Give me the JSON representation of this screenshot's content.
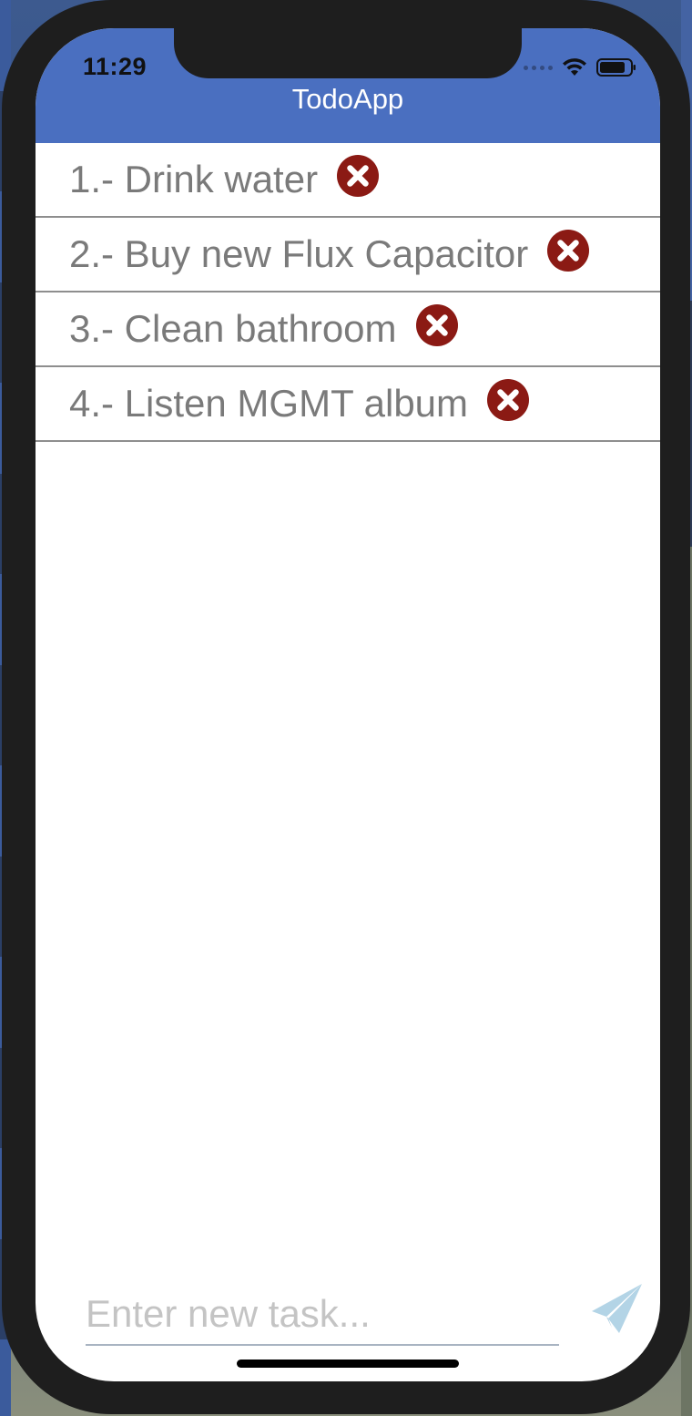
{
  "status_bar": {
    "time": "11:29"
  },
  "header": {
    "title": "TodoApp",
    "background_color": "#4a6fc0"
  },
  "tasks": [
    {
      "label": "1.- Drink water"
    },
    {
      "label": "2.- Buy new Flux Capacitor"
    },
    {
      "label": "3.- Clean bathroom"
    },
    {
      "label": "4.- Listen MGMT album"
    }
  ],
  "icons": {
    "delete": "x-circle-icon",
    "send": "paper-plane-icon",
    "wifi": "wifi-icon",
    "battery": "battery-icon"
  },
  "colors": {
    "delete_icon": "#8b1a14",
    "send_icon": "#b3d4e6"
  },
  "new_task": {
    "placeholder": "Enter new task...",
    "value": ""
  }
}
